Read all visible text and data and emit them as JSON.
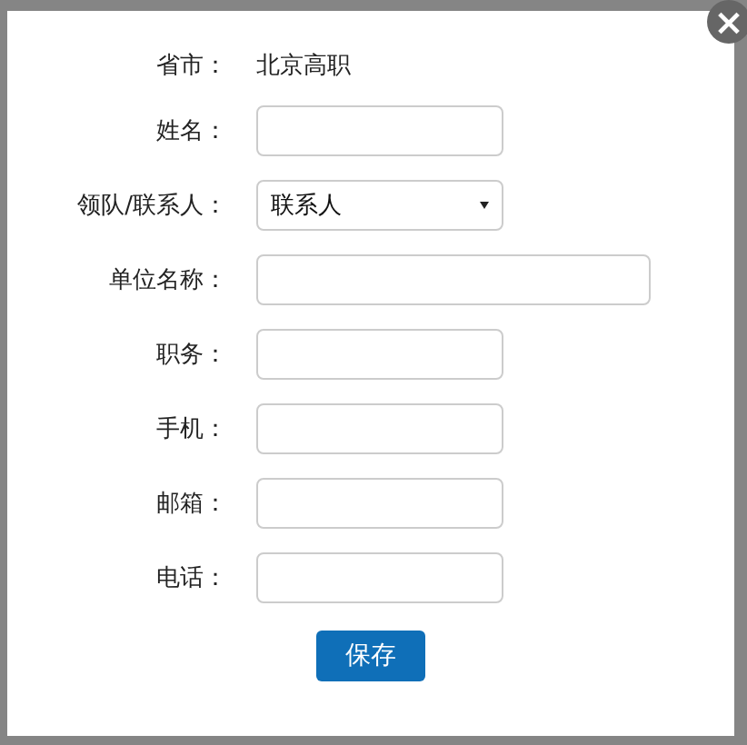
{
  "form": {
    "rows": [
      {
        "kind": "text",
        "label": "省市：",
        "value": "北京高职"
      },
      {
        "kind": "input",
        "label": "姓名："
      },
      {
        "kind": "select",
        "label": "领队/联系人：",
        "value": "联系人"
      },
      {
        "kind": "wide-input",
        "label": "单位名称："
      },
      {
        "kind": "input",
        "label": "职务："
      },
      {
        "kind": "input",
        "label": "手机："
      },
      {
        "kind": "input",
        "label": "邮箱："
      },
      {
        "kind": "input",
        "label": "电话："
      }
    ]
  },
  "buttons": [
    {
      "label": "保存"
    }
  ],
  "close_button": {
    "label": "×"
  }
}
